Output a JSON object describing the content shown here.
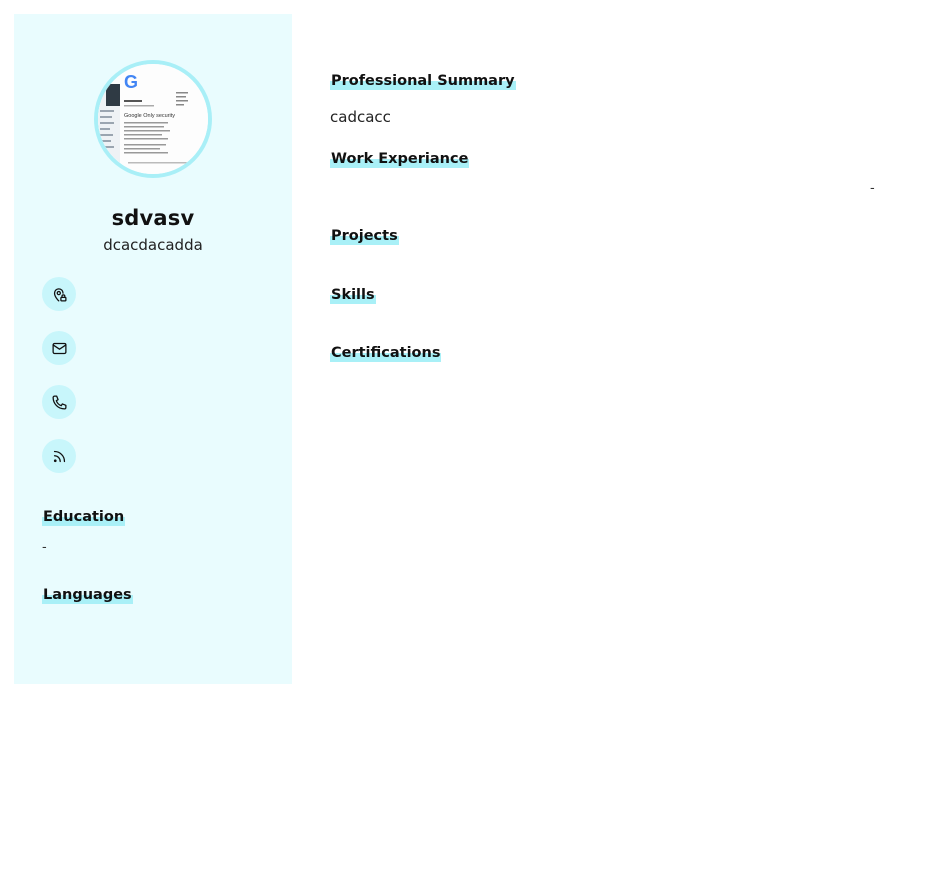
{
  "profile": {
    "name": "sdvasv",
    "tagline": "dcacdacadda",
    "avatar_logo_letter": "G",
    "avatar_page_heading": "Google Only security"
  },
  "contacts": [
    {
      "icon": "location-icon"
    },
    {
      "icon": "mail-icon"
    },
    {
      "icon": "phone-icon"
    },
    {
      "icon": "rss-icon"
    }
  ],
  "sidebar_sections": {
    "education": {
      "title": "Education",
      "value": "-"
    },
    "languages": {
      "title": "Languages"
    }
  },
  "main_sections": {
    "summary": {
      "title": "Professional Summary",
      "text": "cadcacc"
    },
    "work": {
      "title": "Work Experiance",
      "value": "-"
    },
    "projects": {
      "title": "Projects"
    },
    "skills": {
      "title": "Skills"
    },
    "certifications": {
      "title": "Certifications"
    }
  },
  "colors": {
    "sidebar_bg": "#e9fcfe",
    "accent": "#a9f0f7",
    "icon_bg": "#c8f6fb"
  }
}
